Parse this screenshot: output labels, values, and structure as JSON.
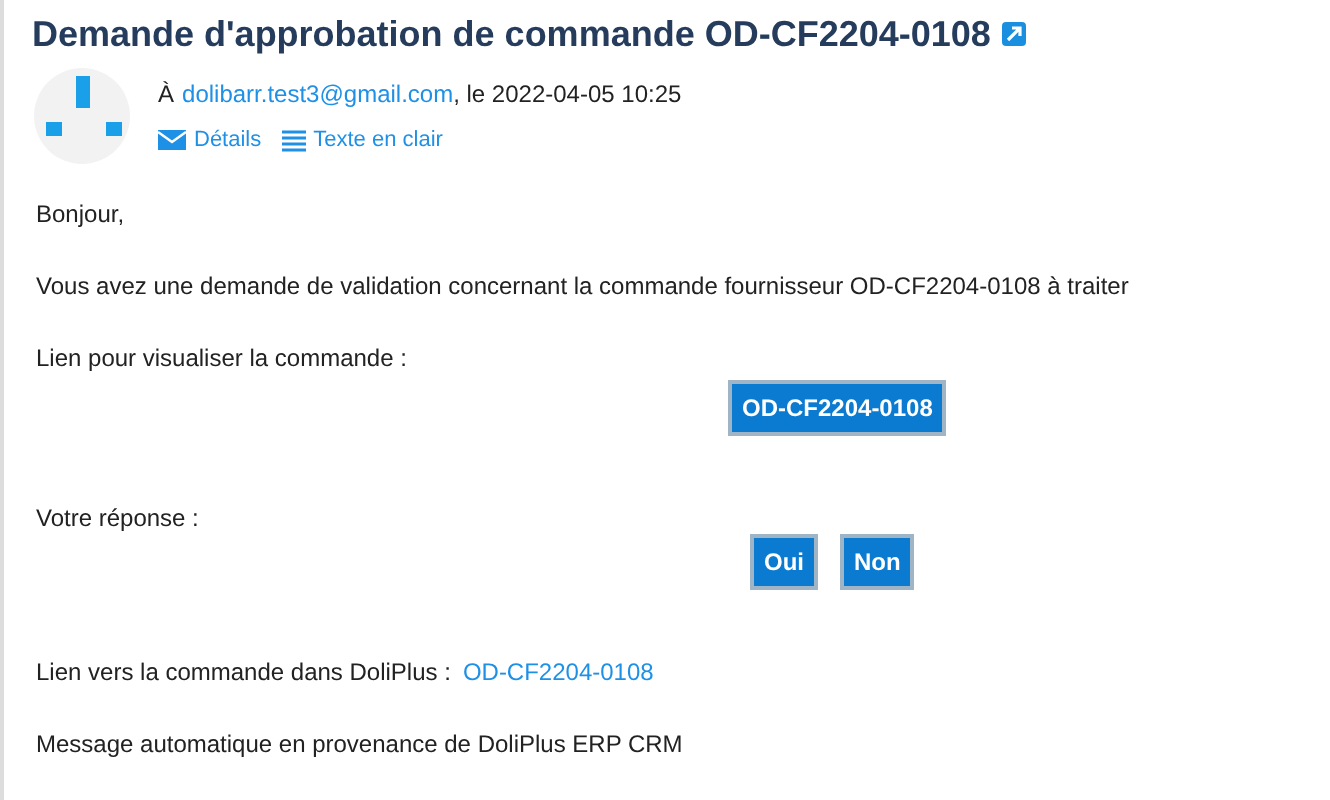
{
  "title": "Demande d'approbation de commande OD-CF2204-0108",
  "header": {
    "prefix": "À",
    "email": "dolibarr.test3@gmail.com",
    "date": ", le 2022-04-05 10:25",
    "links": [
      "Détails",
      "Texte en clair"
    ]
  },
  "body": {
    "greeting": "Bonjour,",
    "message": "Vous avez une demande de validation concernant la commande fournisseur OD-CF2204-0108 à traiter",
    "view_label": "Lien pour visualiser la commande :",
    "view_button": "OD-CF2204-0108",
    "answer_label": "Votre réponse :",
    "answers": [
      "Oui",
      "Non"
    ],
    "link_label": "Lien vers la commande dans DoliPlus :",
    "link": "OD-CF2204-0108",
    "footer": "Message automatique en provenance de DoliPlus ERP CRM"
  }
}
